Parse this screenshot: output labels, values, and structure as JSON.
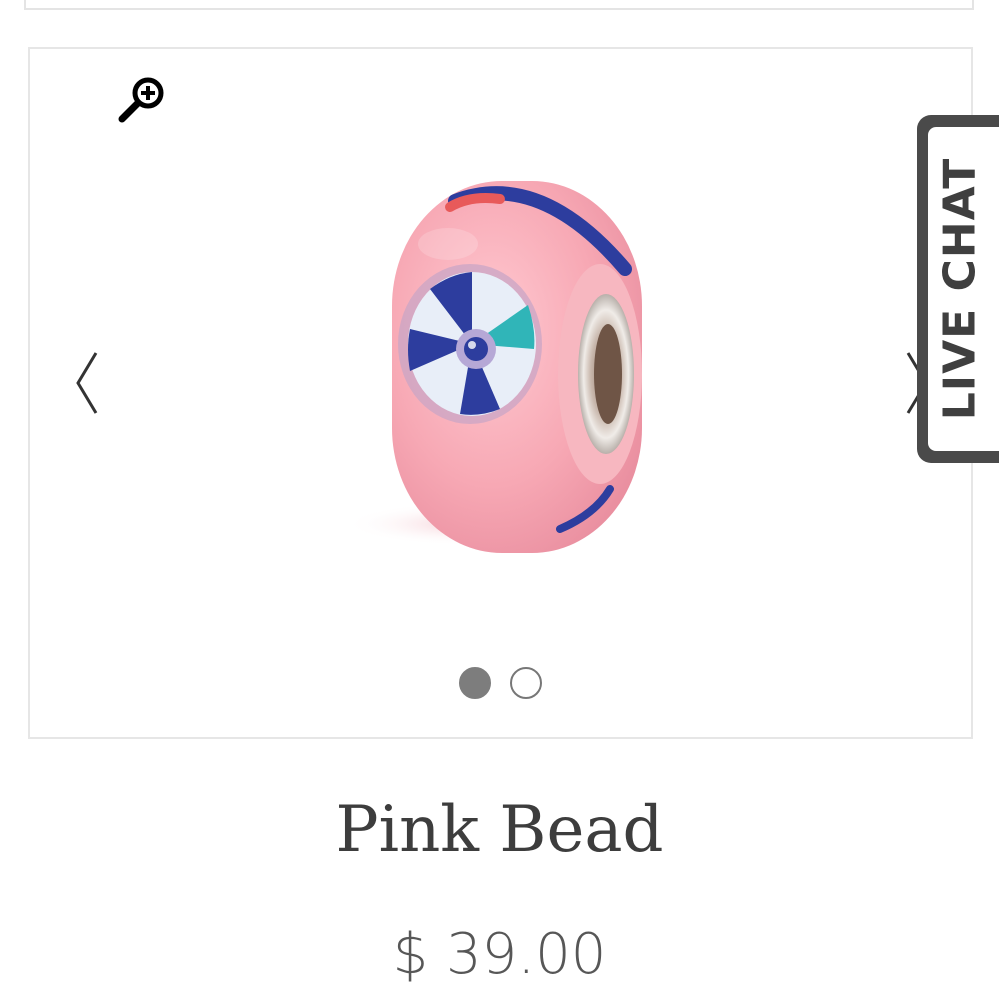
{
  "gallery": {
    "zoom_icon": "zoom-in-icon",
    "prev_icon": "chevron-left-icon",
    "next_icon": "chevron-right-icon",
    "image_alt": "Pink Bead",
    "slides_total": 2,
    "active_slide": 1
  },
  "live_chat": {
    "label": "LIVE CHAT"
  },
  "product": {
    "title": "Pink Bead",
    "price": "$ 39.00"
  },
  "colors": {
    "bead_pink": "#f5a9b4",
    "bead_blue": "#2d3d9e",
    "text_dark": "#3d3d3d",
    "border": "#e6e6e6",
    "dot_active": "#7d7d7d"
  }
}
